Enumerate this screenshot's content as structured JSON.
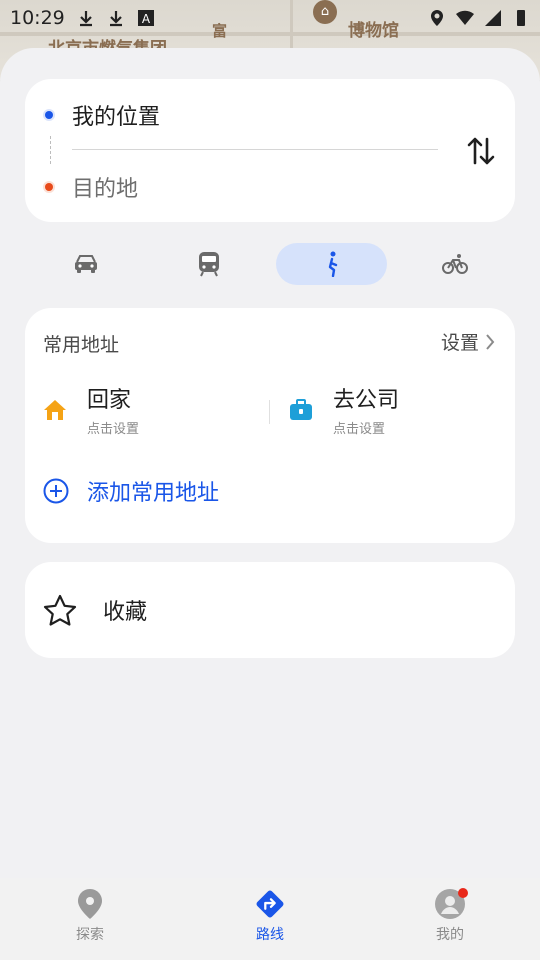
{
  "status_bar": {
    "time": "10:29"
  },
  "map": {
    "labels": [
      "北京市燃气集团",
      "博物馆",
      "富"
    ]
  },
  "route": {
    "origin": "我的位置",
    "destination_placeholder": "目的地",
    "swap_icon": "swap-vertical-icon"
  },
  "modes": [
    {
      "name": "car",
      "icon": "car-icon",
      "active": false
    },
    {
      "name": "transit",
      "icon": "bus-icon",
      "active": false
    },
    {
      "name": "walk",
      "icon": "walk-icon",
      "active": true
    },
    {
      "name": "bike",
      "icon": "bike-icon",
      "active": false
    }
  ],
  "common": {
    "title": "常用地址",
    "settings_label": "设置",
    "home": {
      "label": "回家",
      "sub": "点击设置"
    },
    "work": {
      "label": "去公司",
      "sub": "点击设置"
    },
    "add_label": "添加常用地址"
  },
  "favorites": {
    "label": "收藏"
  },
  "nav": {
    "explore": "探索",
    "route": "路线",
    "mine": "我的"
  },
  "colors": {
    "accent": "#1a56e8",
    "active_mode_bg": "#d6e2fb",
    "home_icon": "#f5a316",
    "work_icon": "#1e9fd8",
    "badge": "#e8281a"
  }
}
